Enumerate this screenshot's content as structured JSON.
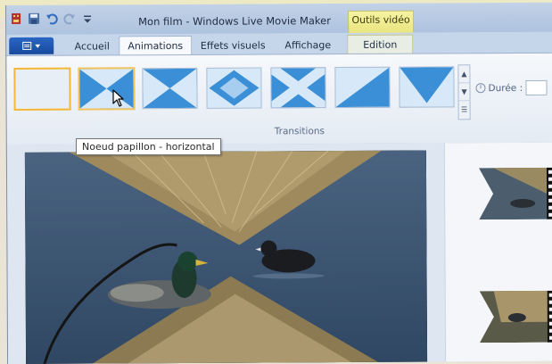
{
  "window": {
    "title": "Mon film - Windows Live Movie Maker"
  },
  "context_tab": {
    "label": "Outils vidéo"
  },
  "tabs": [
    {
      "label": "Accueil",
      "active": false
    },
    {
      "label": "Animations",
      "active": true
    },
    {
      "label": "Effets visuels",
      "active": false
    },
    {
      "label": "Affichage",
      "active": false
    },
    {
      "label": "Edition",
      "active": false,
      "context": true
    }
  ],
  "ribbon": {
    "group_label": "Transitions",
    "duration_label": "Durée :",
    "transitions": [
      {
        "name": "Aucune",
        "pattern": "none",
        "state": "selected"
      },
      {
        "name": "Noeud papillon - horizontal",
        "pattern": "bowtie-horizontal",
        "state": "hover"
      },
      {
        "name": "Noeud papillon - vertical",
        "pattern": "bowtie-vertical",
        "state": "normal"
      },
      {
        "name": "Losange",
        "pattern": "diamond",
        "state": "normal"
      },
      {
        "name": "Croix",
        "pattern": "cross",
        "state": "normal"
      },
      {
        "name": "Diagonale",
        "pattern": "diagonal",
        "state": "normal"
      },
      {
        "name": "Pointe",
        "pattern": "chevron",
        "state": "normal"
      }
    ]
  },
  "tooltip": {
    "text": "Noeud papillon - horizontal"
  },
  "icons": {
    "app": "movie-maker-icon",
    "save": "save-icon",
    "undo": "undo-icon",
    "redo": "redo-icon",
    "customize": "qat-customize-icon",
    "duration": "clock-icon",
    "cursor": "mouse-pointer-icon"
  },
  "colors": {
    "ribbon_bg": "#eef3f9",
    "tab_bar": "#c6d6ea",
    "accent_blue": "#2b66c4",
    "context_yellow": "#f2ee9a",
    "selection_orange": "#f3b73a",
    "transition_blue": "#3b8fd6"
  }
}
